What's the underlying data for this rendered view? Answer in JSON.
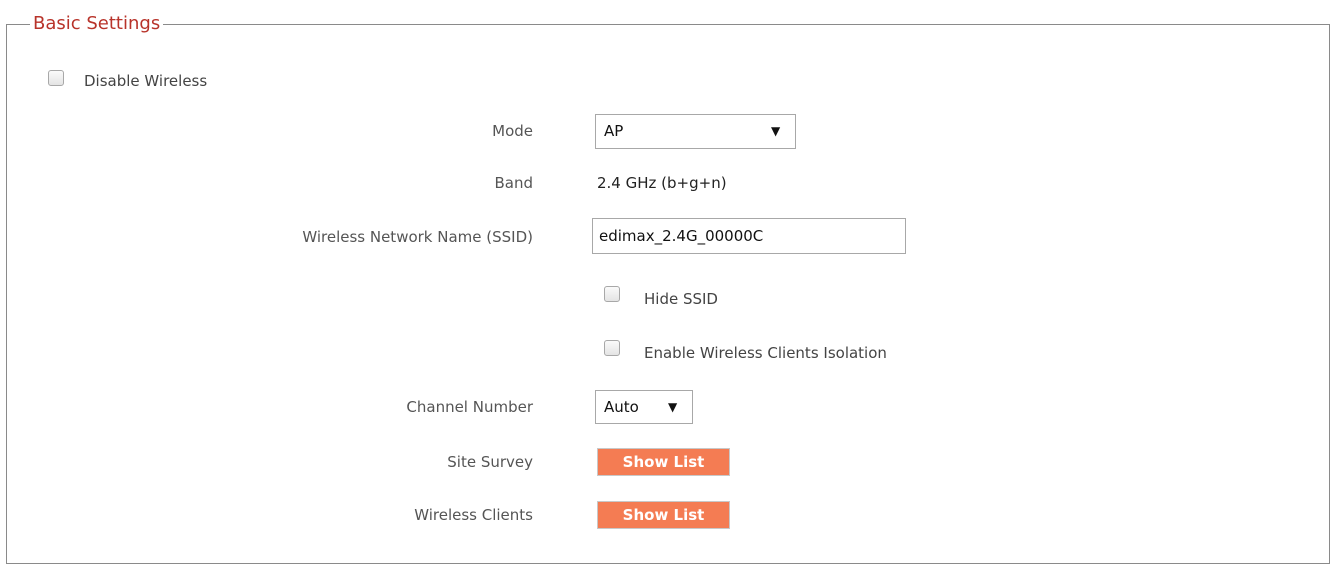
{
  "section": {
    "title": "Basic Settings"
  },
  "disable_wireless": {
    "label": "Disable  Wireless",
    "checked": false
  },
  "fields": {
    "mode": {
      "label": "Mode",
      "value": "AP"
    },
    "band": {
      "label": "Band",
      "value": "2.4 GHz (b+g+n)"
    },
    "ssid": {
      "label": "Wireless Network Name  (SSID)",
      "value": "edimax_2.4G_00000C"
    },
    "hide_ssid": {
      "label": "Hide SSID",
      "checked": false
    },
    "client_isolation": {
      "label": "Enable Wireless Clients Isolation",
      "checked": false
    },
    "channel": {
      "label": "Channel Number",
      "value": "Auto"
    },
    "site_survey": {
      "label": "Site Survey",
      "button": "Show List"
    },
    "wireless_clients": {
      "label": "Wireless Clients",
      "button": "Show List"
    }
  },
  "icons": {
    "dropdown": "triangle-down-icon"
  },
  "colors": {
    "section_title": "#b8332a",
    "button_bg": "#f47c53",
    "button_text": "#ffffff"
  }
}
